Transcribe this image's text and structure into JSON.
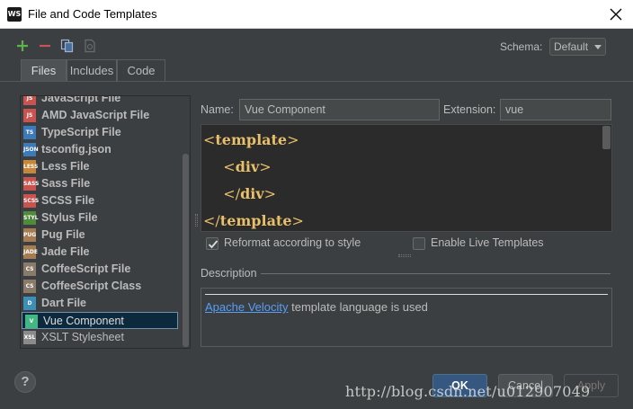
{
  "window": {
    "title": "File and Code Templates",
    "app_icon_text": "WS"
  },
  "toolbar": {
    "add_icon": "plus-icon",
    "remove_icon": "minus-icon",
    "copy_icon": "copy-icon",
    "reset_icon": "reset-icon",
    "schema_label": "Schema:",
    "schema_value": "Default"
  },
  "tabs": [
    {
      "label": "Files",
      "active": true
    },
    {
      "label": "Includes",
      "active": false
    },
    {
      "label": "Code",
      "active": false
    }
  ],
  "template_list": {
    "items": [
      {
        "label": "JavaScript File",
        "icon_text": "JS",
        "icon_color": "#c75450"
      },
      {
        "label": "AMD JavaScript File",
        "icon_text": "JS",
        "icon_color": "#c75450"
      },
      {
        "label": "TypeScript File",
        "icon_text": "TS",
        "icon_color": "#3d7ab8"
      },
      {
        "label": "tsconfig.json",
        "icon_text": "JSON",
        "icon_color": "#3d7ab8"
      },
      {
        "label": "Less File",
        "icon_text": "LESS",
        "icon_color": "#c7873a"
      },
      {
        "label": "Sass File",
        "icon_text": "SASS",
        "icon_color": "#c75450"
      },
      {
        "label": "SCSS File",
        "icon_text": "SCSS",
        "icon_color": "#c75450"
      },
      {
        "label": "Stylus File",
        "icon_text": "STYL",
        "icon_color": "#4f8a3d"
      },
      {
        "label": "Pug File",
        "icon_text": "PUG",
        "icon_color": "#a67c52"
      },
      {
        "label": "Jade File",
        "icon_text": "JADE",
        "icon_color": "#a67c52"
      },
      {
        "label": "CoffeeScript File",
        "icon_text": "CS",
        "icon_color": "#8a7a6a"
      },
      {
        "label": "CoffeeScript Class",
        "icon_text": "CS",
        "icon_color": "#8a7a6a"
      },
      {
        "label": "Dart File",
        "icon_text": "D",
        "icon_color": "#3d8fb8"
      },
      {
        "label": "Vue Component",
        "icon_text": "V",
        "icon_color": "#41b883",
        "selected": true
      },
      {
        "label": "XSLT Stylesheet",
        "icon_text": "XSL",
        "icon_color": "#8a8a8a",
        "plain": true
      }
    ]
  },
  "form": {
    "name_label": "Name:",
    "name_value": "Vue Component",
    "extension_label": "Extension:",
    "extension_value": "vue"
  },
  "editor": {
    "lines": [
      {
        "open": "<",
        "tag": "template",
        "close": ">",
        "indent": ""
      },
      {
        "open": "<",
        "tag": "div",
        "close": ">",
        "indent": "    "
      },
      {
        "open": "</",
        "tag": "div",
        "close": ">",
        "indent": "    "
      },
      {
        "open": "</",
        "tag": "template",
        "close": ">",
        "indent": ""
      }
    ]
  },
  "options": {
    "reformat_label": "Reformat according to style",
    "reformat_checked": true,
    "live_templates_label": "Enable Live Templates",
    "live_templates_checked": false
  },
  "description": {
    "label": "Description",
    "link_text": "Apache Velocity",
    "rest_text": " template language is used"
  },
  "buttons": {
    "help": "?",
    "ok": "OK",
    "cancel": "Cancel",
    "apply": "Apply"
  },
  "watermark": "http://blog.csdn.net/u012907049"
}
